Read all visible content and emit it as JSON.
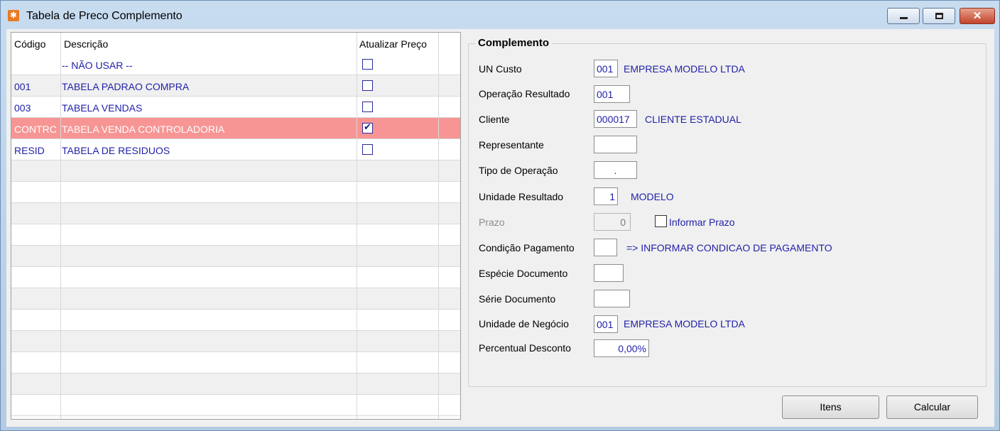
{
  "window": {
    "title": "Tabela de Preco Complemento",
    "app_icon": "app-logo-icon",
    "controls": {
      "minimize": "minimize-icon",
      "maximize": "maximize-icon",
      "close": "✕"
    }
  },
  "grid": {
    "columns": [
      "Código",
      "Descrição",
      "Atualizar Preço"
    ],
    "rows": [
      {
        "code": "",
        "description": "-- NÃO USAR --",
        "update_price": false
      },
      {
        "code": "001",
        "description": "TABELA PADRAO COMPRA",
        "update_price": false
      },
      {
        "code": "003",
        "description": "TABELA VENDAS",
        "update_price": false
      },
      {
        "code": "CONTRC",
        "description": "TABELA VENDA CONTROLADORIA",
        "update_price": true,
        "selected": true
      },
      {
        "code": "RESID",
        "description": "TABELA DE RESIDUOS",
        "update_price": false
      }
    ]
  },
  "complemento": {
    "title": "Complemento",
    "un_custo": {
      "label": "UN Custo",
      "code": "001",
      "desc": "EMPRESA MODELO LTDA"
    },
    "operacao_resultado": {
      "label": "Operação Resultado",
      "code": "001"
    },
    "cliente": {
      "label": "Cliente",
      "code": "000017",
      "desc": "CLIENTE ESTADUAL"
    },
    "representante": {
      "label": "Representante",
      "value": ""
    },
    "tipo_operacao": {
      "label": "Tipo de Operação",
      "value": "."
    },
    "unidade_resultado": {
      "label": "Unidade Resultado",
      "code": "1",
      "desc": "MODELO"
    },
    "prazo": {
      "label": "Prazo",
      "value": "0",
      "checkbox_label": "Informar Prazo",
      "checked": false
    },
    "condicao_pagamento": {
      "label": "Condição Pagamento",
      "value": "",
      "desc": "=> INFORMAR CONDICAO DE PAGAMENTO"
    },
    "especie_documento": {
      "label": "Espécie Documento",
      "value": ""
    },
    "serie_documento": {
      "label": "Série Documento",
      "value": ""
    },
    "unidade_negocio": {
      "label": "Unidade de Negócio",
      "code": "001",
      "desc": "EMPRESA MODELO LTDA"
    },
    "percentual_desconto": {
      "label": "Percentual Desconto",
      "value": "0,00%"
    }
  },
  "buttons": {
    "itens": {
      "label": "Itens"
    },
    "calcular": {
      "label": "Calcular"
    }
  }
}
